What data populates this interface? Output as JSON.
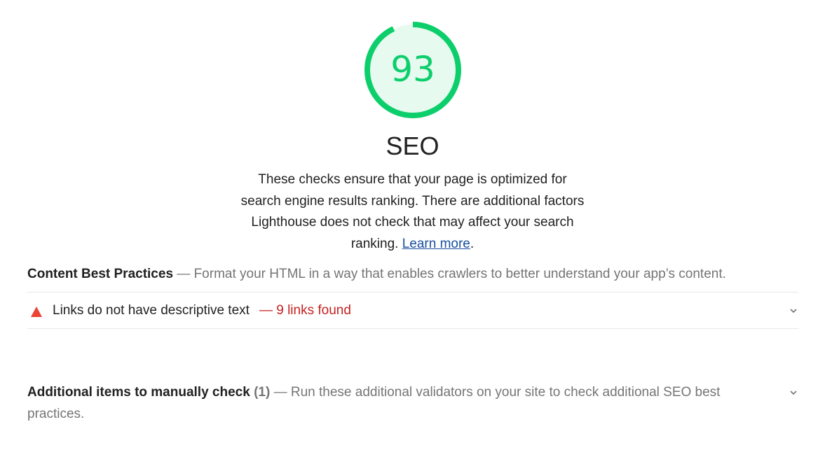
{
  "category": {
    "score": "93",
    "score_fraction": 0.93,
    "title": "SEO",
    "description_prefix": "These checks ensure that your page is optimized for search engine results ranking. There are additional factors Lighthouse does not check that may affect your search ranking. ",
    "learn_more_label": "Learn more",
    "description_suffix": ".",
    "colors": {
      "pass": "#0cce6b",
      "pass_bg": "#e6faf0",
      "fail": "#c5221f",
      "warn_icon": "#eb4335"
    }
  },
  "content_group": {
    "title": "Content Best Practices",
    "separator": " — ",
    "description": "Format your HTML in a way that enables crawlers to better understand your app’s content."
  },
  "audits": [
    {
      "icon": "warning-triangle-icon",
      "title": "Links do not have descriptive text",
      "separator": "— ",
      "display_value": "9 links found"
    }
  ],
  "manual_group": {
    "title": "Additional items to manually check",
    "count": "(1)",
    "separator": " — ",
    "description": "Run these additional validators on your site to check additional SEO best practices."
  }
}
